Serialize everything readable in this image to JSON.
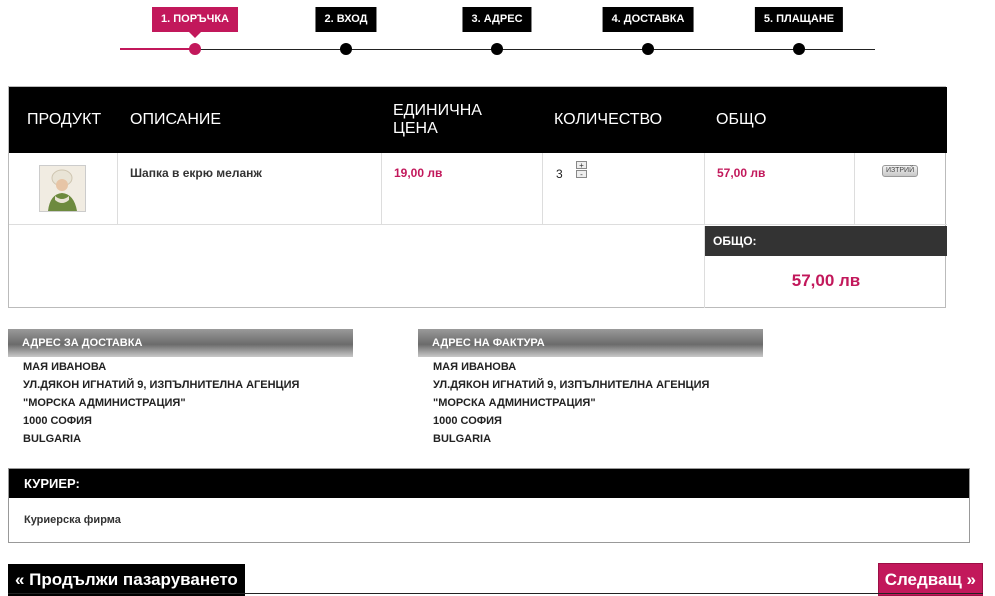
{
  "steps": [
    {
      "label": "1. ПОРЪЧКА",
      "active": true
    },
    {
      "label": "2. ВХОД",
      "active": false
    },
    {
      "label": "3. АДРЕС",
      "active": false
    },
    {
      "label": "4. ДОСТАВКА",
      "active": false
    },
    {
      "label": "5. ПЛАЩАНЕ",
      "active": false
    }
  ],
  "cart": {
    "headers": {
      "product": "ПРОДУКТ",
      "description": "ОПИСАНИЕ",
      "unit_price": "ЕДИНИЧНА ЦЕНА",
      "quantity": "КОЛИЧЕСТВО",
      "total": "ОБЩО"
    },
    "items": [
      {
        "description": "Шапка в екрю меланж",
        "unit_price": "19,00 лв",
        "quantity": "3",
        "total": "57,00 лв",
        "delete_label": "ИЗТРИЙ"
      }
    ],
    "qty_plus": "+",
    "qty_minus": "-",
    "total_label": "ОБЩО:",
    "total_value": "57,00 лв"
  },
  "delivery_address": {
    "title": "АДРЕС ЗА ДОСТАВКА",
    "lines": [
      "МАЯ ИВАНОВА",
      "УЛ.ДЯКОН ИГНАТИЙ 9, ИЗПЪЛНИТЕЛНА АГЕНЦИЯ",
      "\"МОРСКА АДМИНИСТРАЦИЯ\"",
      "1000 СОФИЯ",
      "BULGARIA"
    ]
  },
  "invoice_address": {
    "title": "АДРЕС НА ФАКТУРА",
    "lines": [
      "МАЯ ИВАНОВА",
      "УЛ.ДЯКОН ИГНАТИЙ 9, ИЗПЪЛНИТЕЛНА АГЕНЦИЯ",
      "\"МОРСКА АДМИНИСТРАЦИЯ\"",
      "1000 СОФИЯ",
      "BULGARIA"
    ]
  },
  "courier": {
    "title": "КУРИЕР:",
    "value": "Куриерска фирма"
  },
  "buttons": {
    "continue": "« Продължи пазаруването",
    "next": "Следващ »"
  },
  "colors": {
    "accent": "#c2185b",
    "header_bg": "#000000"
  }
}
